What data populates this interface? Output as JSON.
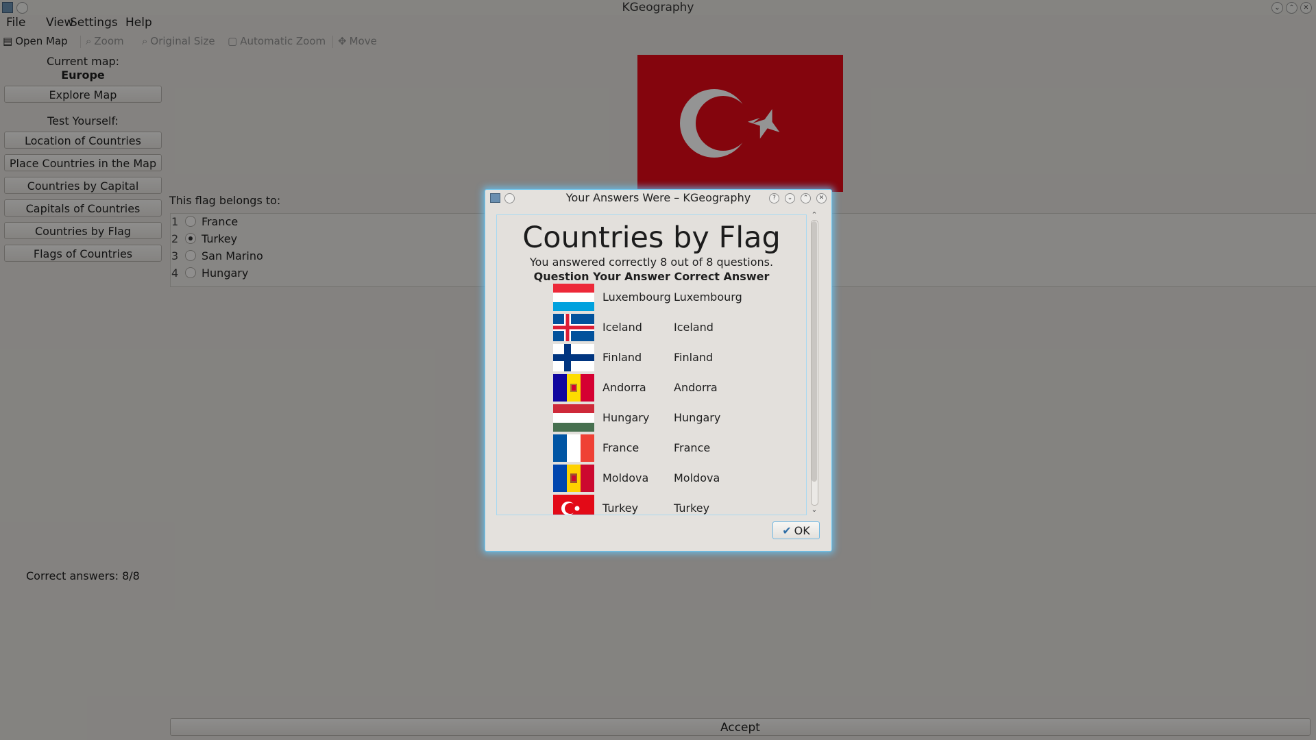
{
  "window": {
    "title": "KGeography"
  },
  "menu": [
    "File",
    "View",
    "Settings",
    "Help"
  ],
  "toolbar": {
    "open_map": "Open Map",
    "zoom": "Zoom",
    "original_size": "Original Size",
    "automatic_zoom": "Automatic Zoom",
    "move": "Move"
  },
  "sidebar": {
    "current_map_label": "Current map:",
    "current_map_value": "Europe",
    "explore_map": "Explore Map",
    "test_yourself": "Test Yourself:",
    "buttons": [
      "Location of Countries",
      "Place Countries in the Map",
      "Countries by Capital",
      "Capitals of Countries",
      "Countries by Flag",
      "Flags of Countries"
    ],
    "correct_answers": "Correct answers: 8/8"
  },
  "question": {
    "prompt": "This flag belongs to:",
    "options": [
      {
        "num": "1",
        "label": "France",
        "selected": false
      },
      {
        "num": "2",
        "label": "Turkey",
        "selected": true
      },
      {
        "num": "3",
        "label": "San Marino",
        "selected": false
      },
      {
        "num": "4",
        "label": "Hungary",
        "selected": false
      }
    ],
    "accept": "Accept"
  },
  "dialog": {
    "title": "Your Answers Were – KGeography",
    "heading": "Countries by Flag",
    "summary": "You answered correctly 8 out of 8 questions.",
    "column_headers": "Question Your Answer Correct Answer",
    "rows": [
      {
        "flag": "luxembourg-flag",
        "your_answer": "Luxembourg",
        "correct_answer": "Luxembourg"
      },
      {
        "flag": "iceland-flag",
        "your_answer": "Iceland",
        "correct_answer": "Iceland"
      },
      {
        "flag": "finland-flag",
        "your_answer": "Finland",
        "correct_answer": "Finland"
      },
      {
        "flag": "andorra-flag",
        "your_answer": "Andorra",
        "correct_answer": "Andorra"
      },
      {
        "flag": "hungary-flag",
        "your_answer": "Hungary",
        "correct_answer": "Hungary"
      },
      {
        "flag": "france-flag",
        "your_answer": "France",
        "correct_answer": "France"
      },
      {
        "flag": "moldova-flag",
        "your_answer": "Moldova",
        "correct_answer": "Moldova"
      },
      {
        "flag": "turkey-flag",
        "your_answer": "Turkey",
        "correct_answer": "Turkey"
      }
    ],
    "ok": "OK"
  },
  "colors": {
    "dialog_glow": "#6ec6ee",
    "turkey_red": "#e30a17"
  }
}
